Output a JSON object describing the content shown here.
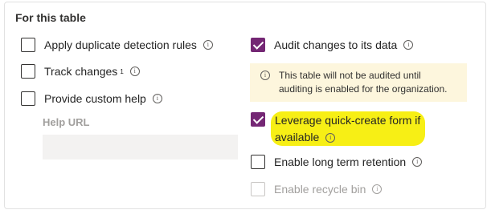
{
  "section": {
    "title": "For this table"
  },
  "left": {
    "duplicate": {
      "label": "Apply duplicate detection rules",
      "checked": false,
      "info_icon": "info-icon"
    },
    "track": {
      "label": "Track changes",
      "superscript": "1",
      "checked": false,
      "info_icon": "info-icon"
    },
    "custom_help": {
      "label": "Provide custom help",
      "checked": false,
      "info_icon": "info-icon"
    },
    "help_url": {
      "label": "Help URL",
      "value": ""
    }
  },
  "right": {
    "audit": {
      "label": "Audit changes to its data",
      "checked": true,
      "info_icon": "info-icon"
    },
    "notice": {
      "text_line1": "This table will not be audited until",
      "text_line2": "auditing is enabled for the organization."
    },
    "quick_create": {
      "label_line1": "Leverage quick-create form if",
      "label_line2": "available",
      "checked": true,
      "highlight_color": "#f7ef15"
    },
    "long_term": {
      "label": "Enable long term retention",
      "checked": false
    },
    "recycle": {
      "label": "Enable recycle bin",
      "checked": false,
      "disabled": true
    }
  },
  "colors": {
    "accent": "#742774",
    "notice_bg": "#fdf6dd",
    "highlight": "#f7ef15"
  }
}
